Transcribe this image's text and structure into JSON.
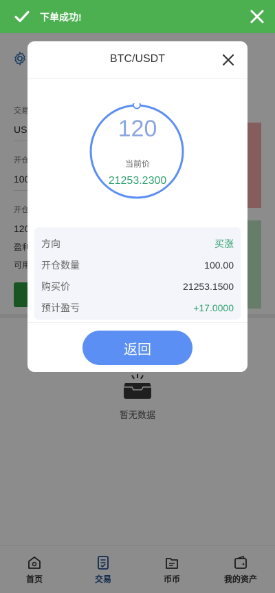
{
  "toast": {
    "message": "下单成功!"
  },
  "modal": {
    "title": "BTC/USDT",
    "countdown": "120",
    "current_price_label": "当前价",
    "current_price": "21253.2300",
    "rows": [
      {
        "key": "方向",
        "value": "买涨",
        "color": "#2ea06e"
      },
      {
        "key": "开仓数量",
        "value": "100.00",
        "color": "#333333"
      },
      {
        "key": "购买价",
        "value": "21253.1500",
        "color": "#333333"
      },
      {
        "key": "预计盈亏",
        "value": "+17.0000",
        "color": "#2ea06e"
      }
    ],
    "return_label": "返回"
  },
  "background": {
    "labels": {
      "trade": "交易",
      "trade_value": "US",
      "open1": "开仓",
      "open1_value": "100",
      "open2": "开仓",
      "open2_value": "120",
      "profit": "盈利",
      "available": "可用"
    },
    "empty_text": "暂无数据"
  },
  "tabbar": [
    {
      "label": "首页",
      "icon": "home-icon",
      "active": false
    },
    {
      "label": "交易",
      "icon": "trade-icon",
      "active": true
    },
    {
      "label": "币币",
      "icon": "coin-icon",
      "active": false
    },
    {
      "label": "我的资产",
      "icon": "wallet-icon",
      "active": false
    }
  ],
  "colors": {
    "toast_bg": "#4caf50",
    "accent_blue": "#5b8ff3",
    "up_green": "#2ea06e"
  }
}
